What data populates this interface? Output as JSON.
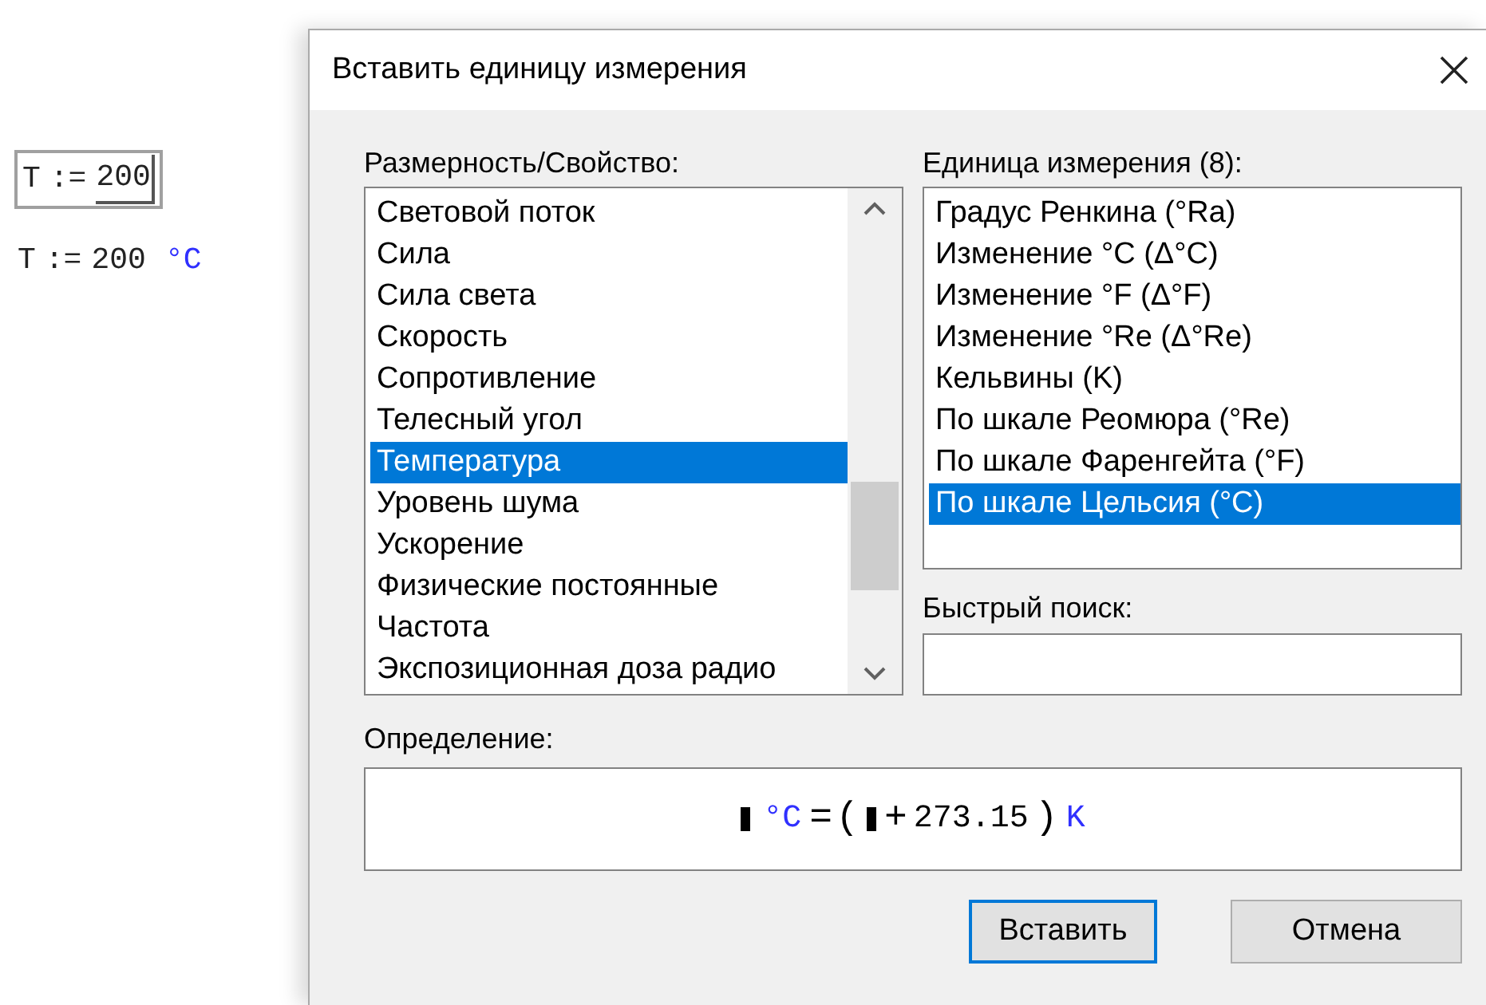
{
  "worksheet": {
    "input": {
      "name": "T",
      "op": ":=",
      "value": "200"
    },
    "result": {
      "name": "T",
      "op": ":=",
      "value": "200",
      "unit": "°C"
    }
  },
  "dialog": {
    "title": "Вставить единицу измерения",
    "dimension": {
      "label": "Размерность/Свойство:",
      "items": [
        {
          "label": "Световой поток",
          "selected": false
        },
        {
          "label": "Сила",
          "selected": false
        },
        {
          "label": "Сила света",
          "selected": false
        },
        {
          "label": "Скорость",
          "selected": false
        },
        {
          "label": "Сопротивление",
          "selected": false
        },
        {
          "label": "Телесный угол",
          "selected": false
        },
        {
          "label": "Температура",
          "selected": true
        },
        {
          "label": "Уровень шума",
          "selected": false
        },
        {
          "label": "Ускорение",
          "selected": false
        },
        {
          "label": "Физические постоянные",
          "selected": false
        },
        {
          "label": "Частота",
          "selected": false
        },
        {
          "label": "Экспозиционная доза радио",
          "selected": false
        }
      ]
    },
    "unit": {
      "label": "Единица измерения (8):",
      "items": [
        {
          "label": "Градус Ренкина (°Ra)",
          "selected": false
        },
        {
          "label": "Изменение °C (Δ°C)",
          "selected": false
        },
        {
          "label": "Изменение °F (Δ°F)",
          "selected": false
        },
        {
          "label": "Изменение °Re (Δ°Re)",
          "selected": false
        },
        {
          "label": "Кельвины (K)",
          "selected": false
        },
        {
          "label": "По шкале Реомюра (°Re)",
          "selected": false
        },
        {
          "label": "По шкале Фаренгейта (°F)",
          "selected": false
        },
        {
          "label": "По шкале Цельсия (°C)",
          "selected": true
        }
      ]
    },
    "search": {
      "label": "Быстрый поиск:"
    },
    "definition": {
      "label": "Определение:",
      "parts": [
        {
          "kind": "placeholder"
        },
        {
          "kind": "unit",
          "text": "°C"
        },
        {
          "kind": "op",
          "text": "="
        },
        {
          "kind": "op",
          "text": "("
        },
        {
          "kind": "placeholder"
        },
        {
          "kind": "op",
          "text": "+"
        },
        {
          "kind": "number",
          "text": "273.15"
        },
        {
          "kind": "op",
          "text": ")"
        },
        {
          "kind": "unit",
          "text": "K"
        }
      ]
    },
    "buttons": [
      {
        "label": "Вставить",
        "default": true
      },
      {
        "label": "Отмена",
        "default": false
      }
    ]
  }
}
